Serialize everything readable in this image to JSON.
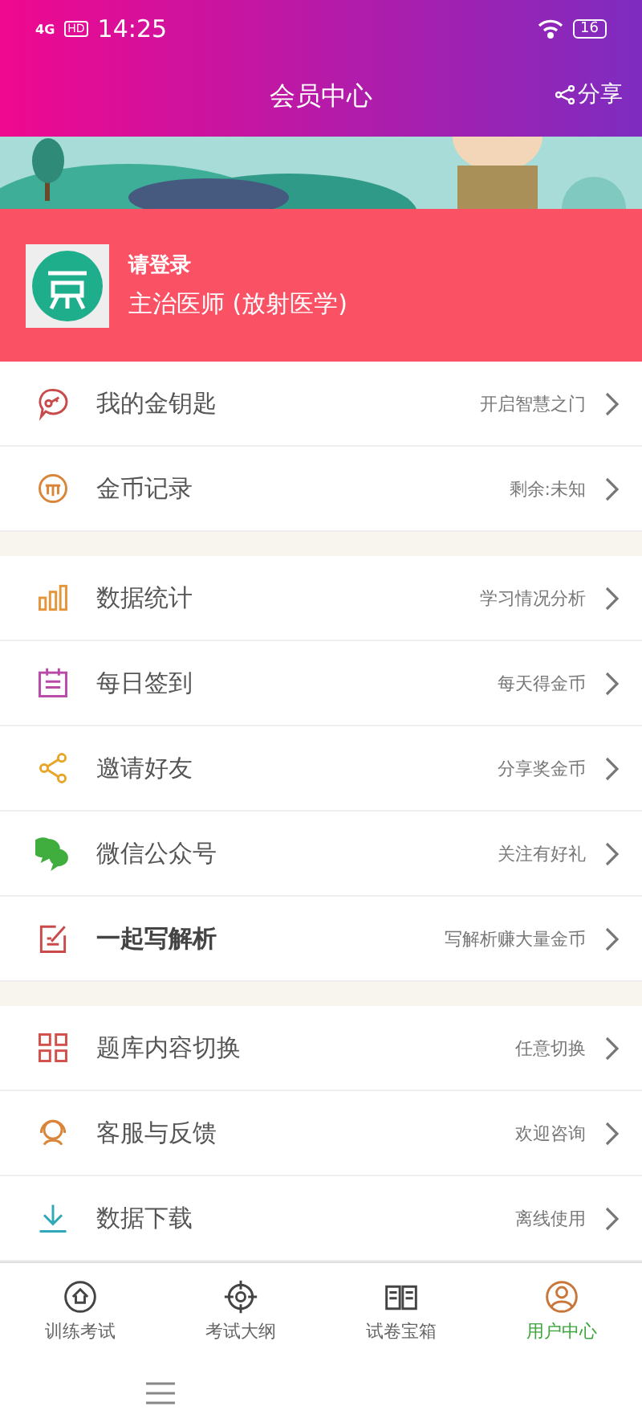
{
  "status_bar": {
    "network": "4G",
    "hd": "HD",
    "time": "14:25",
    "battery": "16"
  },
  "header": {
    "title": "会员中心",
    "share": "分享"
  },
  "profile": {
    "login": "请登录",
    "subtitle": "主治医师 (放射医学)"
  },
  "sections": [
    {
      "items": [
        {
          "label": "我的金钥匙",
          "hint": "开启智慧之门",
          "emphasis": false
        },
        {
          "label": "金币记录",
          "hint": "剩余:未知",
          "emphasis": false
        }
      ]
    },
    {
      "items": [
        {
          "label": "数据统计",
          "hint": "学习情况分析",
          "emphasis": false
        },
        {
          "label": "每日签到",
          "hint": "每天得金币",
          "emphasis": false
        },
        {
          "label": "邀请好友",
          "hint": "分享奖金币",
          "emphasis": false
        },
        {
          "label": "微信公众号",
          "hint": "关注有好礼",
          "emphasis": false
        },
        {
          "label": "一起写解析",
          "hint": "写解析赚大量金币",
          "emphasis": true
        }
      ]
    },
    {
      "items": [
        {
          "label": "题库内容切换",
          "hint": "任意切换",
          "emphasis": false
        },
        {
          "label": "客服与反馈",
          "hint": "欢迎咨询",
          "emphasis": false
        },
        {
          "label": "数据下载",
          "hint": "离线使用",
          "emphasis": false
        }
      ]
    }
  ],
  "tab_bar": [
    {
      "label": "训练考试",
      "selected": false
    },
    {
      "label": "考试大纲",
      "selected": false
    },
    {
      "label": "试卷宝箱",
      "selected": false
    },
    {
      "label": "用户中心",
      "selected": true
    }
  ]
}
